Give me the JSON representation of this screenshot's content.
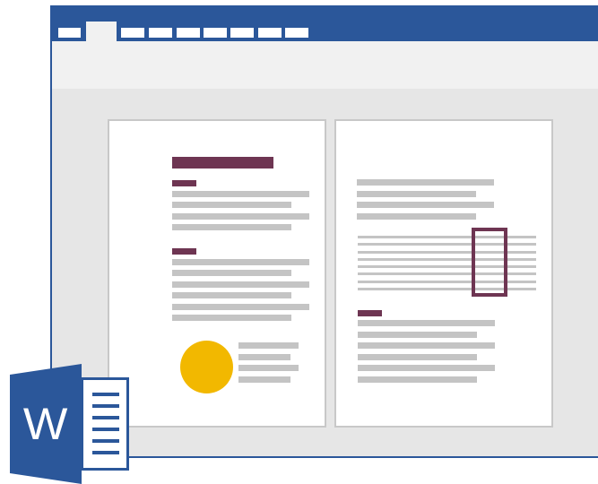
{
  "app": {
    "logo_letter": "W",
    "icon": "word-logo-icon"
  },
  "colors": {
    "brand_blue": "#2b579a",
    "accent_plum": "#6e3552",
    "accent_yellow": "#f2b800",
    "placeholder_gray": "#c4c4c4",
    "canvas_gray": "#e6e6e6",
    "ribbon_gray": "#f1f1f1"
  },
  "titlebar": {
    "tabs": [
      "",
      "",
      "",
      "",
      "",
      "",
      "",
      "",
      ""
    ],
    "active_tab_index": 1
  },
  "pages": [
    {
      "name": "page-left",
      "content": [
        "heading-bar",
        "subheading",
        "text-lines",
        "subheading",
        "text-lines",
        "image-circle",
        "caption-lines"
      ]
    },
    {
      "name": "page-right",
      "content": [
        "text-lines",
        "table-lines",
        "highlight-box",
        "subheading",
        "text-lines"
      ]
    }
  ]
}
